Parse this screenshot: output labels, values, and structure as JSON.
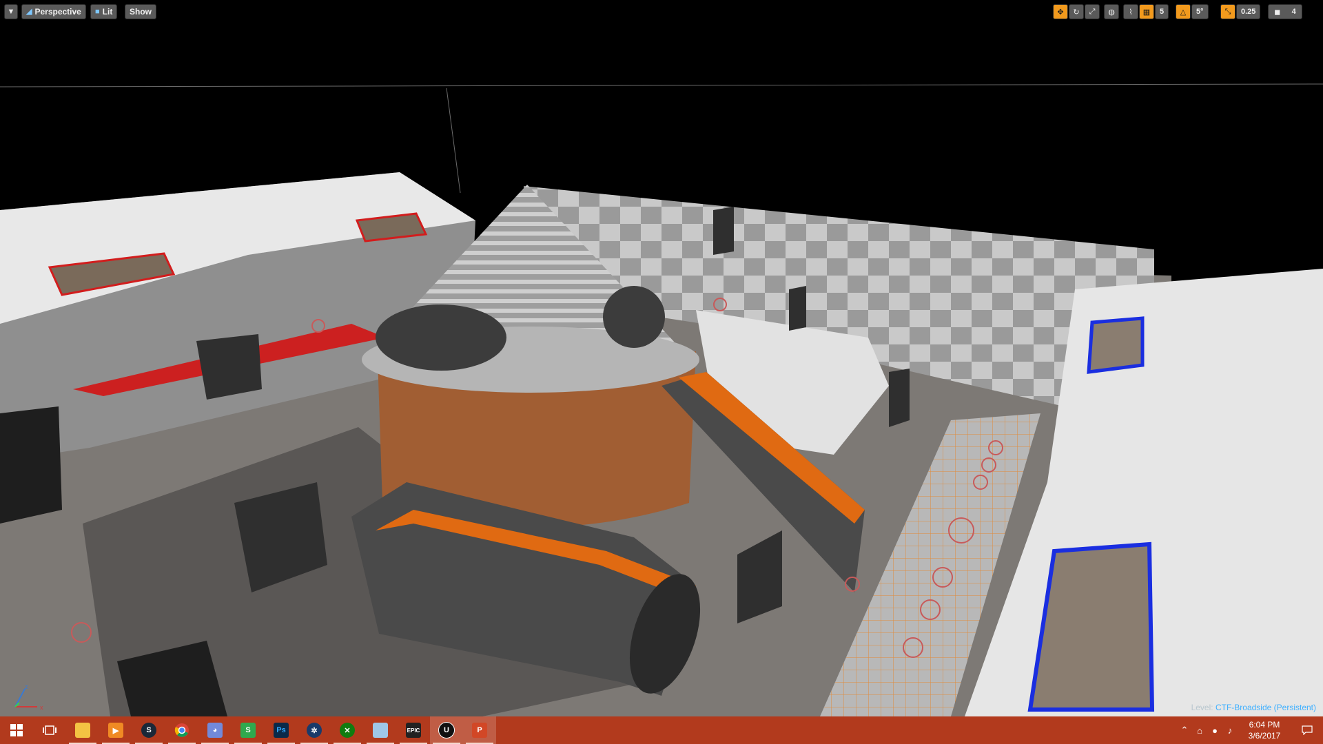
{
  "toolbar": {
    "menu_icon": "chevron-down-icon",
    "perspective_label": "Perspective",
    "lit_label": "Lit",
    "show_label": "Show",
    "grid_snap_value": "5",
    "rotation_snap_value": "5°",
    "scale_snap_value": "0.25",
    "camera_speed_value": "4"
  },
  "viewport": {
    "level_prefix": "Level:",
    "level_name": "CTF-Broadside (Persistent)",
    "axis_labels": {
      "x": "x",
      "z": "z"
    }
  },
  "taskbar": {
    "apps": [
      {
        "name": "start",
        "icon": "windows-icon"
      },
      {
        "name": "task-view",
        "icon": "task-view-icon"
      },
      {
        "name": "file-explorer",
        "icon": "folder-icon"
      },
      {
        "name": "media",
        "icon": "media-player-icon"
      },
      {
        "name": "steam",
        "icon": "steam-icon"
      },
      {
        "name": "chrome",
        "icon": "chrome-icon"
      },
      {
        "name": "discord",
        "icon": "discord-icon"
      },
      {
        "name": "skype",
        "icon": "skype-icon"
      },
      {
        "name": "photoshop",
        "icon": "photoshop-icon"
      },
      {
        "name": "app-8",
        "icon": "wheel-icon"
      },
      {
        "name": "xbox",
        "icon": "xbox-icon"
      },
      {
        "name": "app-10",
        "icon": "tile-icon"
      },
      {
        "name": "epic-games",
        "icon": "epic-games-icon",
        "label": "EPIC"
      },
      {
        "name": "unreal-engine",
        "icon": "unreal-icon"
      },
      {
        "name": "powerpoint",
        "icon": "powerpoint-icon"
      }
    ],
    "time": "6:04 PM",
    "date": "3/6/2017"
  },
  "colors": {
    "taskbar": "#b23a1d",
    "accent_orange": "#f29a1d",
    "level_name": "#3fb0ff"
  }
}
